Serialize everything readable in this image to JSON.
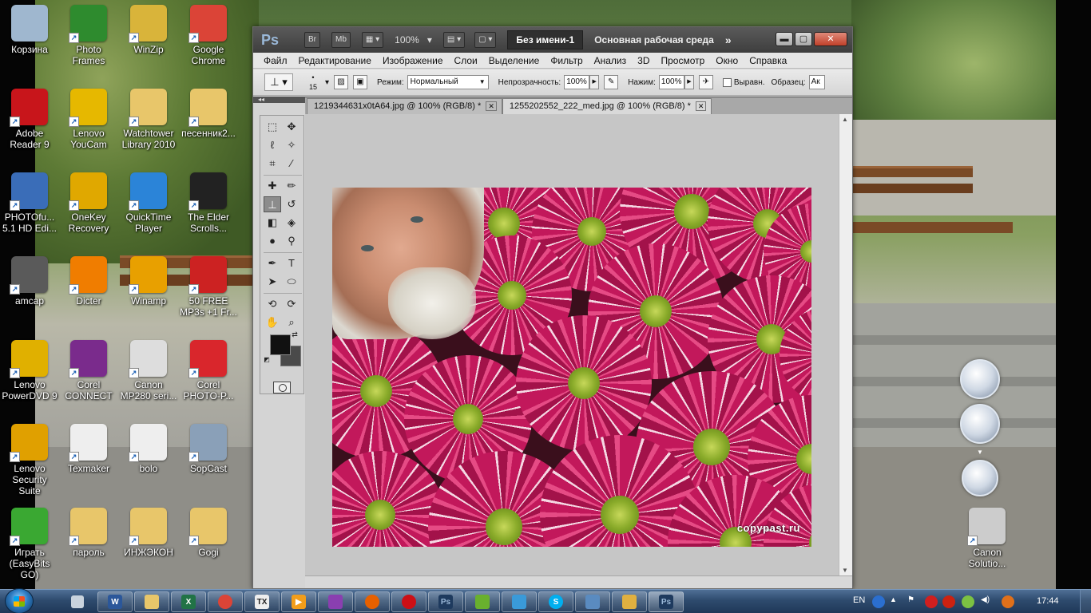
{
  "desktop": {
    "icons": [
      {
        "label": "Корзина",
        "icon": "recycle-bin-icon",
        "color": "#9fb7cf"
      },
      {
        "label": "Photo Frames",
        "icon": "photo-frames-icon",
        "color": "#2e8b2e"
      },
      {
        "label": "WinZip",
        "icon": "winzip-icon",
        "color": "#d9b43a"
      },
      {
        "label": "Google Chrome",
        "icon": "chrome-icon",
        "color": "#db4437"
      },
      {
        "label": "Adobe Reader 9",
        "icon": "adobe-reader-icon",
        "color": "#c8151b"
      },
      {
        "label": "Lenovo YouCam",
        "icon": "youcam-icon",
        "color": "#e6b800"
      },
      {
        "label": "Watchtower Library 2010",
        "icon": "folder-icon",
        "color": "#e8c66a"
      },
      {
        "label": "песенник2...",
        "icon": "folder-icon",
        "color": "#e8c66a"
      },
      {
        "label": "PHOTOfu... 5.1 HD Edi...",
        "icon": "photofun-icon",
        "color": "#3a6db8"
      },
      {
        "label": "OneKey Recovery",
        "icon": "onekey-icon",
        "color": "#e0a800"
      },
      {
        "label": "QuickTime Player",
        "icon": "quicktime-icon",
        "color": "#2b84d8"
      },
      {
        "label": "The Elder Scrolls...",
        "icon": "skyrim-icon",
        "color": "#222222"
      },
      {
        "label": "amcap",
        "icon": "amcap-icon",
        "color": "#5a5a5a"
      },
      {
        "label": "Dicter",
        "icon": "dicter-icon",
        "color": "#f07d00"
      },
      {
        "label": "Winamp",
        "icon": "winamp-icon",
        "color": "#e8a000"
      },
      {
        "label": "50 FREE MP3s +1 Fr...",
        "icon": "mp3-icon",
        "color": "#cc2222"
      },
      {
        "label": "Lenovo PowerDVD 9",
        "icon": "powerdvd-icon",
        "color": "#e0b000"
      },
      {
        "label": "Corel CONNECT",
        "icon": "corel-connect-icon",
        "color": "#7a2b8c"
      },
      {
        "label": "Canon MP280 seri...",
        "icon": "canon-printer-icon",
        "color": "#dddddd"
      },
      {
        "label": "Corel PHOTO-P...",
        "icon": "corel-photo-icon",
        "color": "#d9262c"
      },
      {
        "label": "Lenovo Security Suite",
        "icon": "security-suite-icon",
        "color": "#e0a000"
      },
      {
        "label": "Texmaker",
        "icon": "texmaker-icon",
        "color": "#eeeeee"
      },
      {
        "label": "bolo",
        "icon": "tex-file-icon",
        "color": "#eeeeee"
      },
      {
        "label": "SopCast",
        "icon": "sopcast-icon",
        "color": "#8aa0b8"
      },
      {
        "label": "Играть (EasyBits GO)",
        "icon": "easybits-go-icon",
        "color": "#3aa832"
      },
      {
        "label": "пароль",
        "icon": "folder-icon",
        "color": "#e8c66a"
      },
      {
        "label": "ИНЖЭКОН",
        "icon": "folder-icon",
        "color": "#e8c66a"
      },
      {
        "label": "Gogi",
        "icon": "folder-icon",
        "color": "#e8c66a"
      },
      {
        "label": "Canon Solutio...",
        "icon": "canon-solution-icon",
        "color": "#cccccc"
      }
    ]
  },
  "photoshop": {
    "appbar": {
      "logo": "Ps",
      "bridge_label": "Br",
      "minibridge_label": "Mb",
      "zoom": "100%",
      "doc_tab": "Без имени-1",
      "workspace": "Основная рабочая среда",
      "more": "»"
    },
    "menu": [
      "Файл",
      "Редактирование",
      "Изображение",
      "Слои",
      "Выделение",
      "Фильтр",
      "Анализ",
      "3D",
      "Просмотр",
      "Окно",
      "Справка"
    ],
    "options": {
      "brush_size": "15",
      "mode_label": "Режим:",
      "mode_value": "Нормальный",
      "opacity_label": "Непрозрачность:",
      "opacity_value": "100%",
      "pressure_label": "Нажим:",
      "pressure_value": "100%",
      "align_label": "Выравн.",
      "sample_label": "Образец:",
      "sample_value": "Ак"
    },
    "document_tabs": [
      {
        "label": "1219344631x0tA64.jpg @ 100% (RGB/8) *",
        "active": false
      },
      {
        "label": "1255202552_222_med.jpg @ 100% (RGB/8) *",
        "active": true
      }
    ],
    "image": {
      "watermark": "copypast.ru"
    },
    "colors": {
      "foreground": "#111111",
      "background": "#4a4a4a"
    }
  },
  "taskbar": {
    "language": "EN",
    "time": "17:44"
  }
}
